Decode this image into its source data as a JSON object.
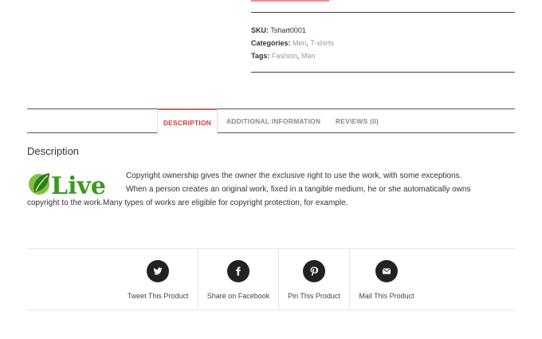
{
  "meta": {
    "sku_label": "SKU:",
    "sku_value": "Tshart0001",
    "categories_label": "Categories:",
    "categories": [
      "Men",
      "T-shirts"
    ],
    "tags_label": "Tags:",
    "tags": [
      "Fashion",
      "Man"
    ],
    "separator": ", "
  },
  "tabs": [
    {
      "label": "DESCRIPTION",
      "active": true
    },
    {
      "label": "ADDITIONAL INFORMATION",
      "active": false
    },
    {
      "label": "REVIEWS (0)",
      "active": false
    }
  ],
  "description": {
    "heading": "Description",
    "logo_text": "Live",
    "line1": "Copyright ownership gives the owner the      exclusive right to use the work, with some exceptions.",
    "line2": "When a person creates an original work, fixed in a tangible medium, he or she automatically owns",
    "line3": "copyright to the work.Many types of works are eligible for copyright protection, for example."
  },
  "share": [
    {
      "label": "Tweet This Product",
      "icon": "twitter-icon"
    },
    {
      "label": "Share on Facebook",
      "icon": "facebook-icon"
    },
    {
      "label": "Pin This Product",
      "icon": "pinterest-icon"
    },
    {
      "label": "Mail This Product",
      "icon": "mail-icon"
    }
  ],
  "colors": {
    "accent": "#d23b3b",
    "link_gray": "#999999",
    "logo_green": "#3a9a1f"
  }
}
